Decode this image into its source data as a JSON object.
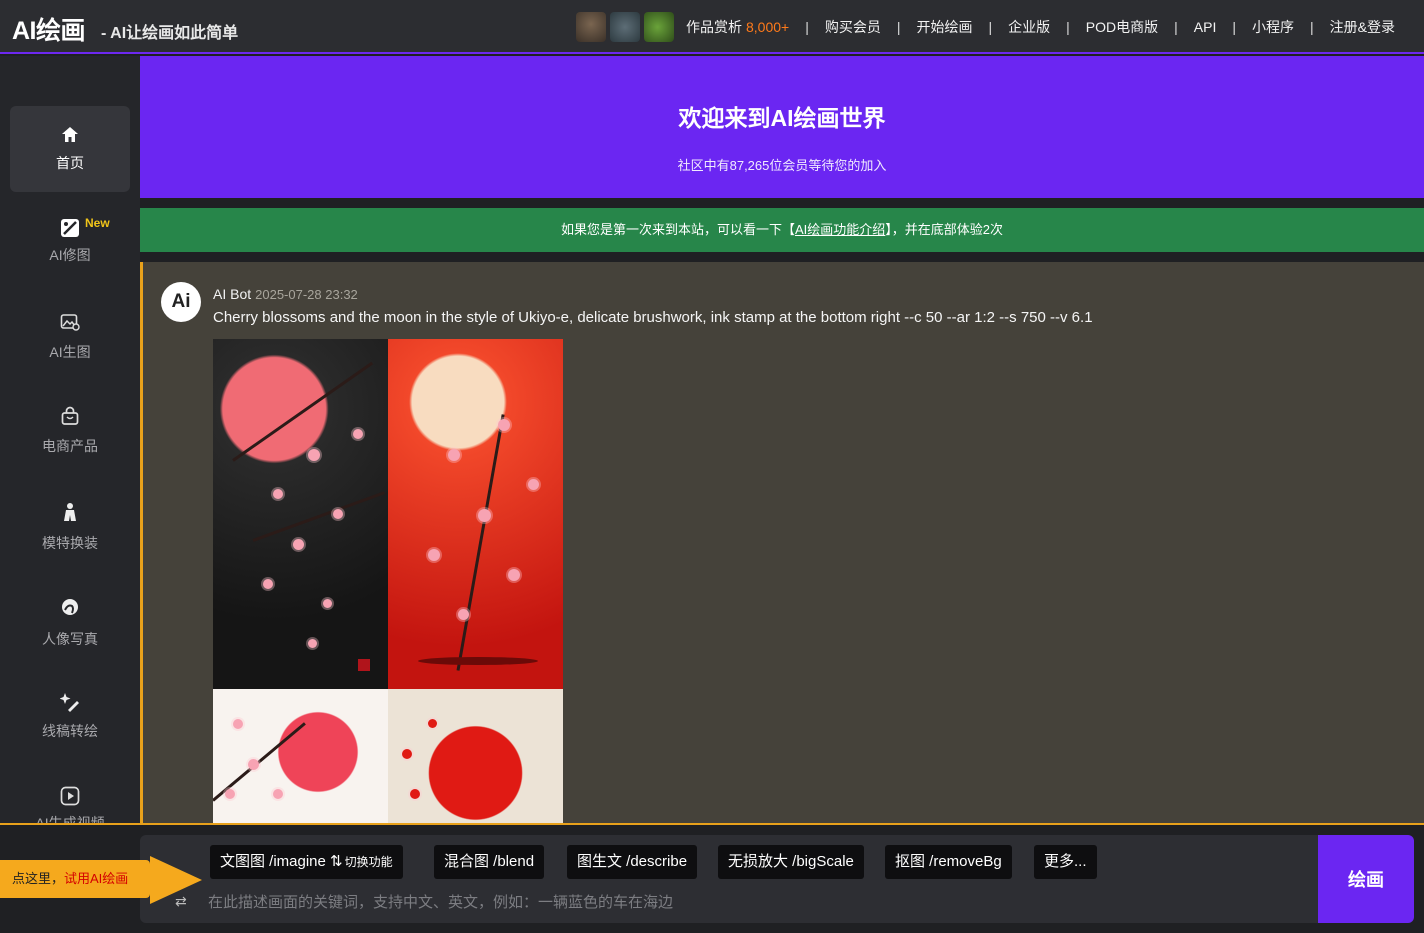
{
  "header": {
    "logo": "AI绘画",
    "tagline": "- AI让绘画如此简单",
    "nav": [
      {
        "label": "作品赏析",
        "accent": "8,000+"
      },
      {
        "label": "购买会员"
      },
      {
        "label": "开始绘画"
      },
      {
        "label": "企业版"
      },
      {
        "label": "POD电商版"
      },
      {
        "label": "API"
      },
      {
        "label": "小程序"
      },
      {
        "label": "注册&登录"
      }
    ],
    "separator": "|"
  },
  "sidebar": {
    "items": [
      {
        "label": "首页",
        "icon": "home-icon"
      },
      {
        "label": "AI修图",
        "icon": "photo-edit-icon",
        "badge": "New"
      },
      {
        "label": "AI生图",
        "icon": "image-generate-icon"
      },
      {
        "label": "电商产品",
        "icon": "shopping-bag-icon"
      },
      {
        "label": "模特换装",
        "icon": "model-icon"
      },
      {
        "label": "人像写真",
        "icon": "portrait-icon"
      },
      {
        "label": "线稿转绘",
        "icon": "sparkle-edit-icon"
      },
      {
        "label": "AI生成视频",
        "icon": "video-play-icon"
      }
    ]
  },
  "hero": {
    "title": "欢迎来到AI绘画世界",
    "subtitle": "社区中有87,265位会员等待您的加入"
  },
  "notice": {
    "prefix": "如果您是第一次来到本站，可以看一下【",
    "link": "AI绘画功能介绍",
    "suffix": "】，并在底部体验2次"
  },
  "message": {
    "avatar": "Ai",
    "author": "AI Bot",
    "time": "2025-07-28 23:32",
    "text": "Cherry blossoms and the moon in the style of Ukiyo-e, delicate brushwork, ink stamp at the bottom right --c 50 --ar 1:2 --s 750 --v 6.1"
  },
  "composer": {
    "commands": [
      {
        "label": "文图图 /imagine",
        "extra": "切换功能"
      },
      {
        "label": "混合图 /blend"
      },
      {
        "label": "图生文 /describe"
      },
      {
        "label": "无损放大 /bigScale"
      },
      {
        "label": "抠图 /removeBg"
      },
      {
        "label": "更多..."
      }
    ],
    "placeholder": "在此描述画面的关键词，支持中文、英文，例如：一辆蓝色的车在海边",
    "submit": "绘画"
  },
  "tip": {
    "prefix": "点这里，",
    "highlight": "试用AI绘画"
  },
  "colors": {
    "accent_purple": "#6b26f2",
    "notice_green": "#27864a",
    "highlight_orange": "#ff7a1a",
    "border_gold": "#e8a11b"
  }
}
